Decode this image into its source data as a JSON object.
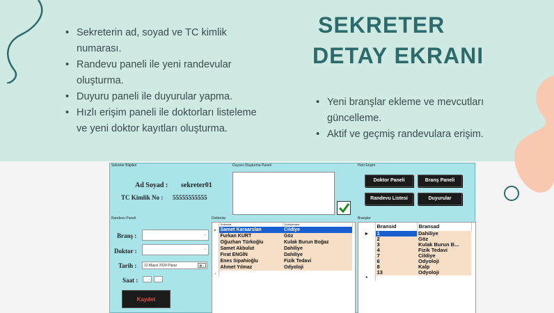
{
  "slide": {
    "title_line1": "SEKRETER",
    "title_line2": "DETAY EKRANI",
    "bullets_left": [
      "Sekreterin ad, soyad ve TC kimlik numarası.",
      "Randevu paneli ile yeni randevular oluşturma.",
      "Duyuru paneli ile duyurular yapma.",
      "Hızlı erişim paneli ile doktorları listeleme ve yeni doktor kayıtları oluşturma."
    ],
    "bullets_right": [
      "Yeni branşlar ekleme ve mevcutları güncelleme.",
      "Aktif ve geçmiş randevulara erişim."
    ],
    "colors": {
      "band": "#cfe9e3",
      "title": "#2d6a6b",
      "peach": "#f8c9b0",
      "window": "#a9e4ea"
    }
  },
  "window": {
    "info_group": "Sekreter Bilgileri",
    "ad_soyad_label": "Ad Soyad :",
    "ad_soyad_value": "sekreter01",
    "tc_label": "TC Kimlik No :",
    "tc_value": "55555555555",
    "duyuru_group": "Duyuru Oluşturma Paneli",
    "hizli_group": "Hızlı Erişim",
    "btn_doktor_paneli": "Doktor Paneli",
    "btn_brans_paneli": "Branş Paneli",
    "btn_randevu_listesi": "Randevu Listesi",
    "btn_duyurular": "Duyurular",
    "randevu_group": "Randevu Paneli",
    "brans_label": "Branş :",
    "doktor_label": "Doktor :",
    "tarih_label": "Tarih :",
    "tarih_value": "12  Mayıs  2024  Pazar",
    "saat_label": "Saat :",
    "kaydet_label": "Kaydet",
    "doktorlar_group": "Doktorlar",
    "doktorlar_headers": [
      "Doktorlar",
      "Doktorbrans"
    ],
    "doktorlar_rows": [
      [
        "Samet Karaarslan",
        "Cildiye"
      ],
      [
        "Furkan KURT",
        "Göz"
      ],
      [
        "Oğuzhan Türkoğlu",
        "Kulak Burun Boğaz"
      ],
      [
        "Samet Akbulut",
        "Dahiliye"
      ],
      [
        "Fırat ENGİN",
        "Dahiliye"
      ],
      [
        "Enes Sipahioğlu",
        "Fizik Tedavi"
      ],
      [
        "Ahmet Yılmaz",
        "Odyoloji"
      ]
    ],
    "branslar_group": "Branşlar",
    "branslar_headers": [
      "Bransid",
      "Bransad"
    ],
    "branslar_rows": [
      [
        "1",
        "Dahiliye"
      ],
      [
        "2",
        "Göz"
      ],
      [
        "3",
        "Kulak Burun B..."
      ],
      [
        "4",
        "Fizik Tedavi"
      ],
      [
        "7",
        "Cildiye"
      ],
      [
        "6",
        "Odyoloji"
      ],
      [
        "8",
        "Kalp"
      ],
      [
        "13",
        "Odyoloji"
      ]
    ]
  }
}
